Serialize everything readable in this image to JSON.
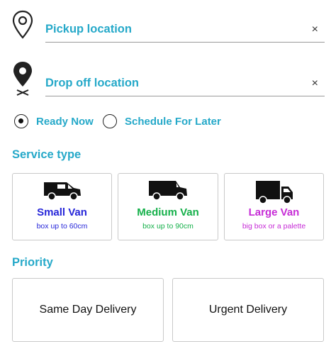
{
  "pickup": {
    "label": "Pickup location",
    "clear": "×"
  },
  "dropoff": {
    "label": "Drop off location",
    "clear": "×"
  },
  "timing": {
    "options": [
      {
        "label": "Ready Now",
        "selected": true
      },
      {
        "label": "Schedule For Later",
        "selected": false
      }
    ]
  },
  "service": {
    "title": "Service type",
    "options": [
      {
        "name": "Small Van",
        "detail": "box up to 60cm",
        "color": "#2626d9",
        "icon": "small-van-icon"
      },
      {
        "name": "Medium Van",
        "detail": "box up to 90cm",
        "color": "#15b04a",
        "icon": "medium-van-icon"
      },
      {
        "name": "Large Van",
        "detail": "big box or a palette",
        "color": "#c62bd6",
        "icon": "large-truck-icon"
      }
    ]
  },
  "priority": {
    "title": "Priority",
    "options": [
      {
        "label": "Same Day Delivery"
      },
      {
        "label": "Urgent Delivery"
      }
    ]
  },
  "accent_color": "#26a9c9"
}
